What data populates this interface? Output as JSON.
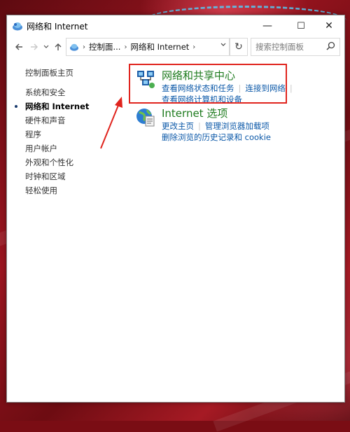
{
  "window": {
    "title": "网络和 Internet",
    "controls": {
      "minimize": "—",
      "maximize": "☐",
      "close": "✕"
    }
  },
  "address_bar": {
    "segments": [
      "控制面...",
      "网络和 Internet"
    ],
    "separator": "›",
    "refresh": "↻"
  },
  "search": {
    "placeholder": "搜索控制面板"
  },
  "sidebar": {
    "home": "控制面板主页",
    "items": [
      "系统和安全",
      "网络和 Internet",
      "硬件和声音",
      "程序",
      "用户帐户",
      "外观和个性化",
      "时钟和区域",
      "轻松使用"
    ],
    "active_index": 1
  },
  "categories": [
    {
      "title": "网络和共享中心",
      "links": [
        "查看网络状态和任务",
        "连接到网络",
        "查看网络计算机和设备"
      ],
      "icon": "network-sharing-icon"
    },
    {
      "title": "Internet 选项",
      "links": [
        "更改主页",
        "管理浏览器加载项",
        "删除浏览的历史记录和 cookie"
      ],
      "icon": "internet-options-icon"
    }
  ],
  "colors": {
    "category_title": "#1e7b1e",
    "link": "#0b58a8",
    "highlight": "#e0241e",
    "background": "#9b1520"
  }
}
